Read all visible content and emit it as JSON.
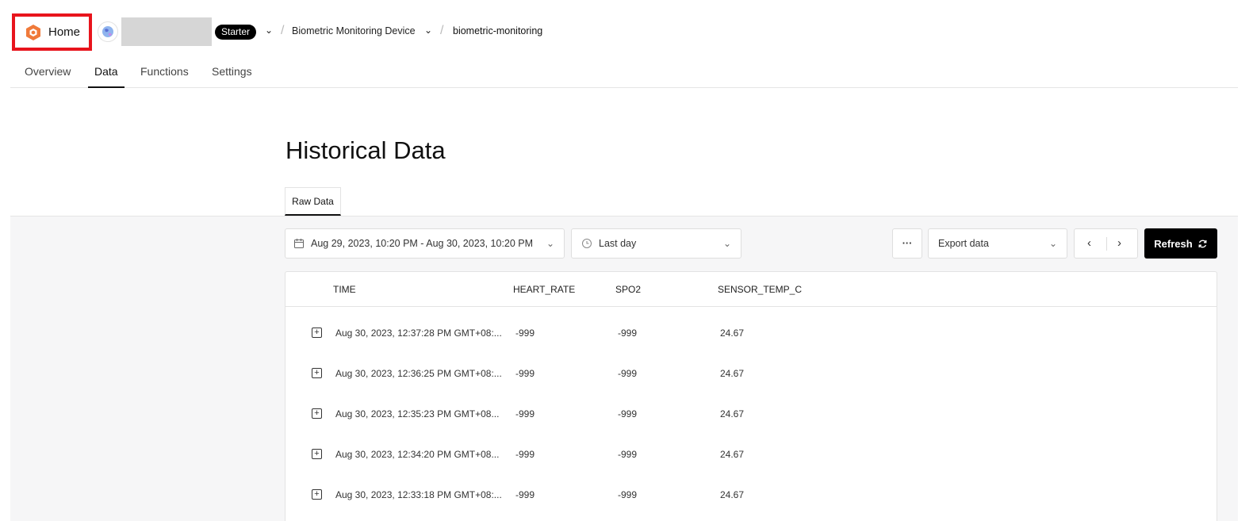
{
  "header": {
    "home_label": "Home",
    "plan_badge": "Starter",
    "breadcrumbs": [
      "Biometric Monitoring Device",
      "biometric-monitoring"
    ]
  },
  "tabs": [
    "Overview",
    "Data",
    "Functions",
    "Settings"
  ],
  "active_tab": "Data",
  "page": {
    "title": "Historical Data",
    "subtab": "Raw Data"
  },
  "controls": {
    "date_range": "Aug 29, 2023, 10:20 PM - Aug 30, 2023, 10:20 PM",
    "period": "Last day",
    "more": "···",
    "export_placeholder": "Export data",
    "refresh_label": "Refresh"
  },
  "table": {
    "columns": [
      "TIME",
      "HEART_RATE",
      "SPO2",
      "SENSOR_TEMP_C"
    ],
    "rows": [
      [
        "Aug 30, 2023, 12:37:28 PM GMT+08:...",
        "-999",
        "-999",
        "24.67"
      ],
      [
        "Aug 30, 2023, 12:36:25 PM GMT+08:...",
        "-999",
        "-999",
        "24.67"
      ],
      [
        "Aug 30, 2023, 12:35:23 PM GMT+08...",
        "-999",
        "-999",
        "24.67"
      ],
      [
        "Aug 30, 2023, 12:34:20 PM GMT+08...",
        "-999",
        "-999",
        "24.67"
      ],
      [
        "Aug 30, 2023, 12:33:18 PM GMT+08:...",
        "-999",
        "-999",
        "24.67"
      ]
    ]
  },
  "colors": {
    "brand_orange": "#f07a3a",
    "highlight_red": "#e8141c",
    "button_black": "#000000"
  }
}
